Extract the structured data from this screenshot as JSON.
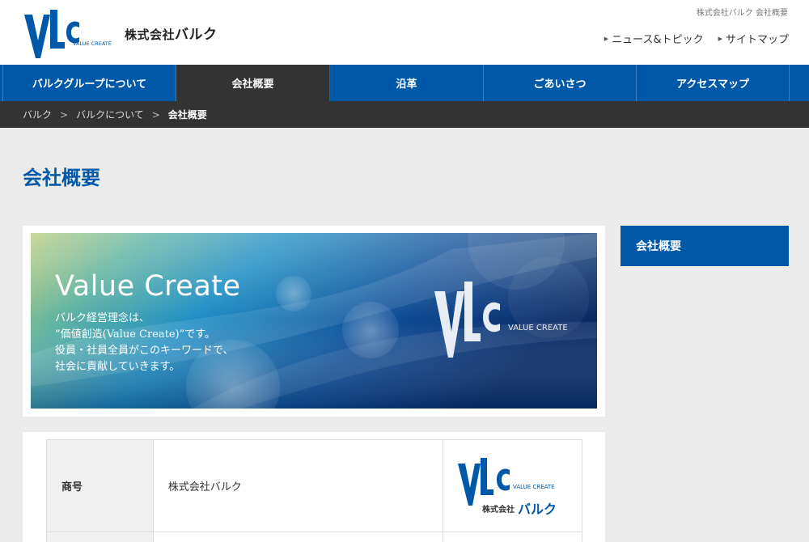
{
  "header": {
    "top_crumb": "株式会社バルク 会社概要",
    "company_prefix": "株式会社",
    "company_name": "バルク",
    "logo_tagline": "VALUE CREATE",
    "util_links": [
      {
        "label": "ニュース&トピック",
        "icon": "triangle-right-icon"
      },
      {
        "label": "サイトマップ",
        "icon": "triangle-right-icon"
      }
    ]
  },
  "nav": {
    "items": [
      {
        "label": "バルクグループについて",
        "active": false
      },
      {
        "label": "会社概要",
        "active": true
      },
      {
        "label": "沿革",
        "active": false
      },
      {
        "label": "ごあいさつ",
        "active": false
      },
      {
        "label": "アクセスマップ",
        "active": false
      }
    ]
  },
  "breadcrumb": {
    "items": [
      "バルク",
      "バルクについて",
      "会社概要"
    ],
    "separator": ">"
  },
  "page": {
    "title": "会社概要"
  },
  "banner": {
    "heading": "Value Create",
    "lines": [
      "バルク経営理念は、",
      "”価値創造(Value Create)”です。",
      "役員・社員全員がこのキーワードで、",
      "社会に貢献していきます。"
    ],
    "logo_tagline": "VALUE CREATE"
  },
  "sidebar": {
    "box_label": "会社概要"
  },
  "info_table": {
    "rows": [
      {
        "label": "商号",
        "value": "株式会社バルク"
      }
    ],
    "logo_tagline": "VALUE CREATE",
    "logo_prefix": "株式会社",
    "logo_name": "バルク"
  },
  "colors": {
    "brand_blue": "#0059a8",
    "dark_bar": "#333333",
    "page_bg": "#ebebeb"
  }
}
